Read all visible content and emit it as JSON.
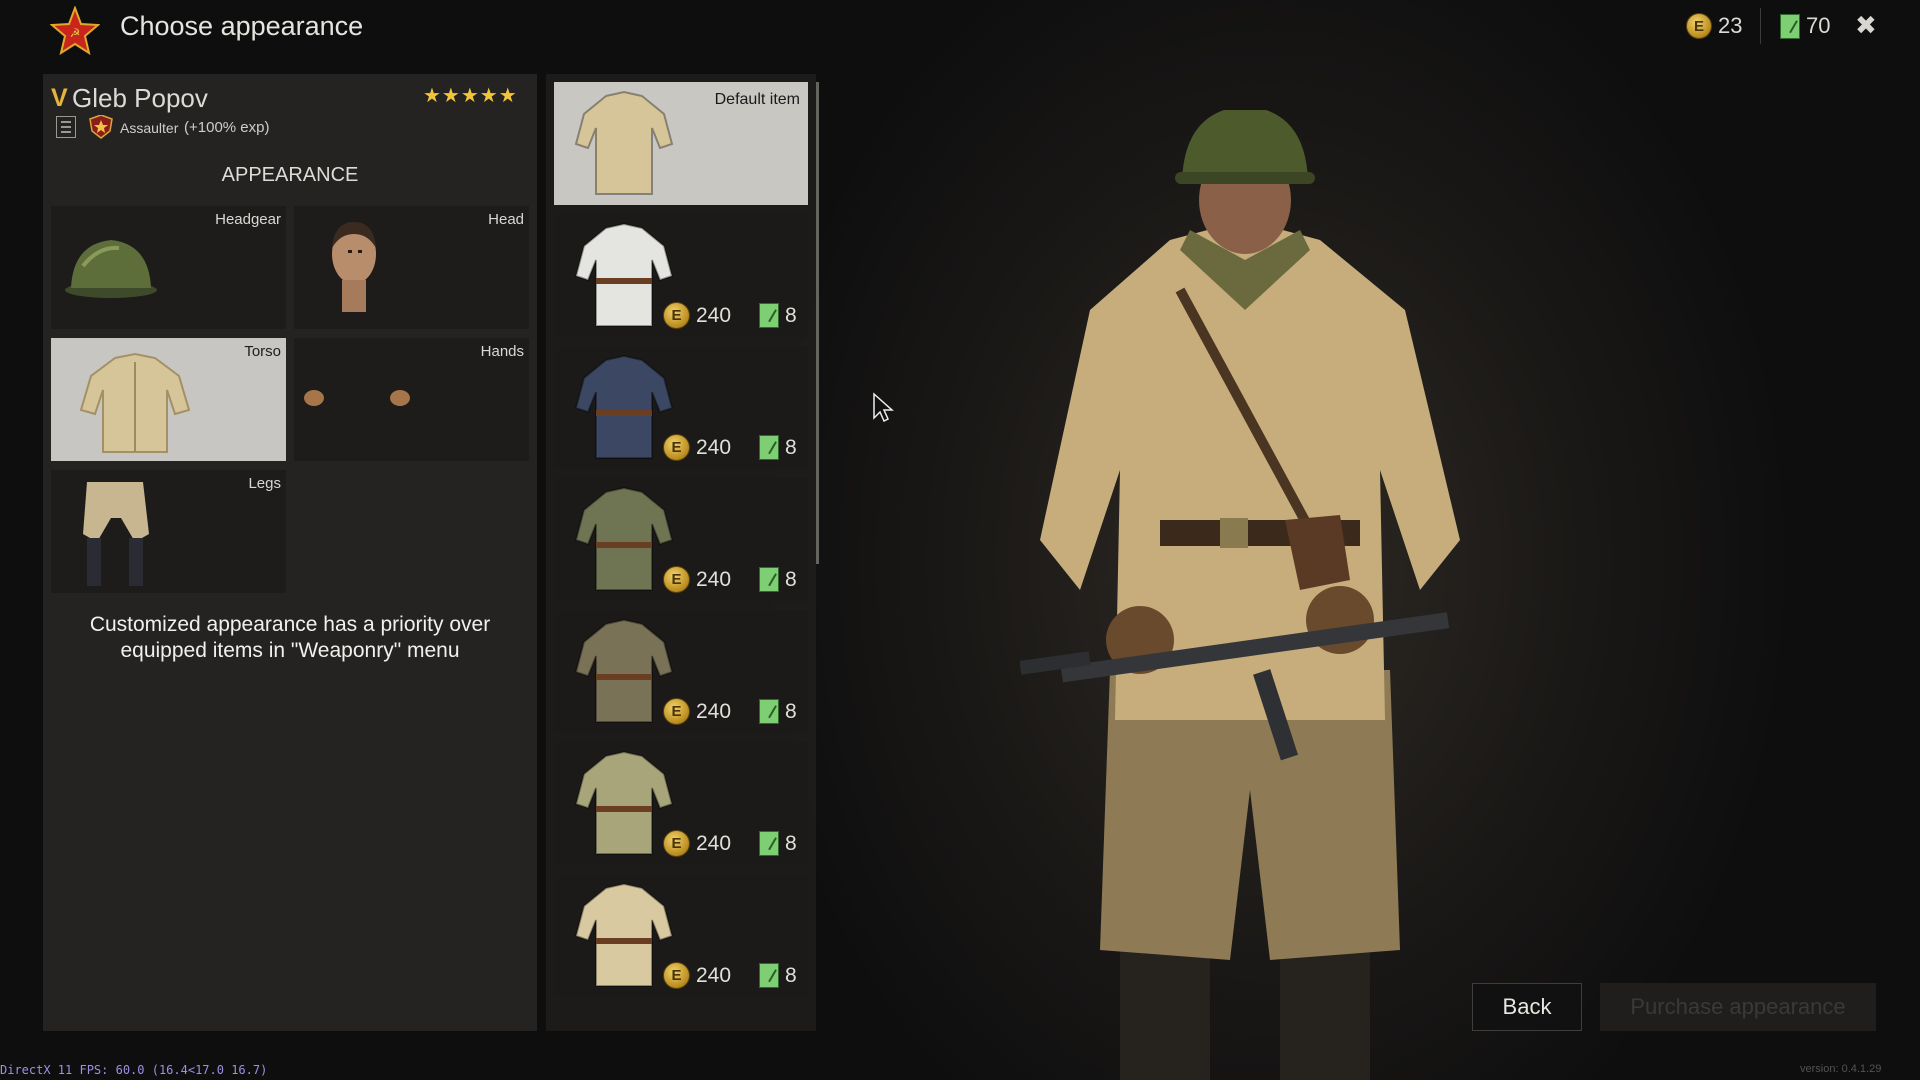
{
  "header": {
    "title": "Choose appearance",
    "logo_icon": "soviet-star-icon",
    "currencies": [
      {
        "icon": "coin-icon",
        "symbol": "E",
        "value": "23"
      },
      {
        "icon": "card-icon",
        "value": "70"
      }
    ],
    "close_icon": "close-icon"
  },
  "soldier": {
    "rank": "V",
    "name": "Gleb Popov",
    "stars": "★★★★★",
    "class": "Assaulter",
    "exp": "(+100% exp)"
  },
  "appearance": {
    "heading": "APPEARANCE",
    "slots": [
      {
        "label": "Headgear",
        "selected": false
      },
      {
        "label": "Head",
        "selected": false
      },
      {
        "label": "Torso",
        "selected": true
      },
      {
        "label": "Hands",
        "selected": false
      },
      {
        "label": "Legs",
        "selected": false
      }
    ],
    "note": "Customized appearance has a priority over equipped items in \"Weaponry\" menu"
  },
  "items": [
    {
      "label": "Default item",
      "selected": true,
      "color": "#d7c59a"
    },
    {
      "coin_symbol": "E",
      "price": "240",
      "cards": "8",
      "color": "#e4e4e0"
    },
    {
      "coin_symbol": "E",
      "price": "240",
      "cards": "8",
      "color": "#3b4763"
    },
    {
      "coin_symbol": "E",
      "price": "240",
      "cards": "8",
      "color": "#6f7553"
    },
    {
      "coin_symbol": "E",
      "price": "240",
      "cards": "8",
      "color": "#7a7257"
    },
    {
      "coin_symbol": "E",
      "price": "240",
      "cards": "8",
      "color": "#a8a57a"
    },
    {
      "coin_symbol": "E",
      "price": "240",
      "cards": "8",
      "color": "#d9c9a0"
    }
  ],
  "buttons": {
    "back": "Back",
    "purchase": "Purchase appearance"
  },
  "debug": {
    "fps": "DirectX 11 FPS: 60.0 (16.4<17.0 16.7)",
    "version": "version: 0.4.1.29"
  },
  "colors": {
    "gold": "#e3b63a",
    "selected_bg": "#c8c6c2",
    "panel_bg": "#262524"
  }
}
